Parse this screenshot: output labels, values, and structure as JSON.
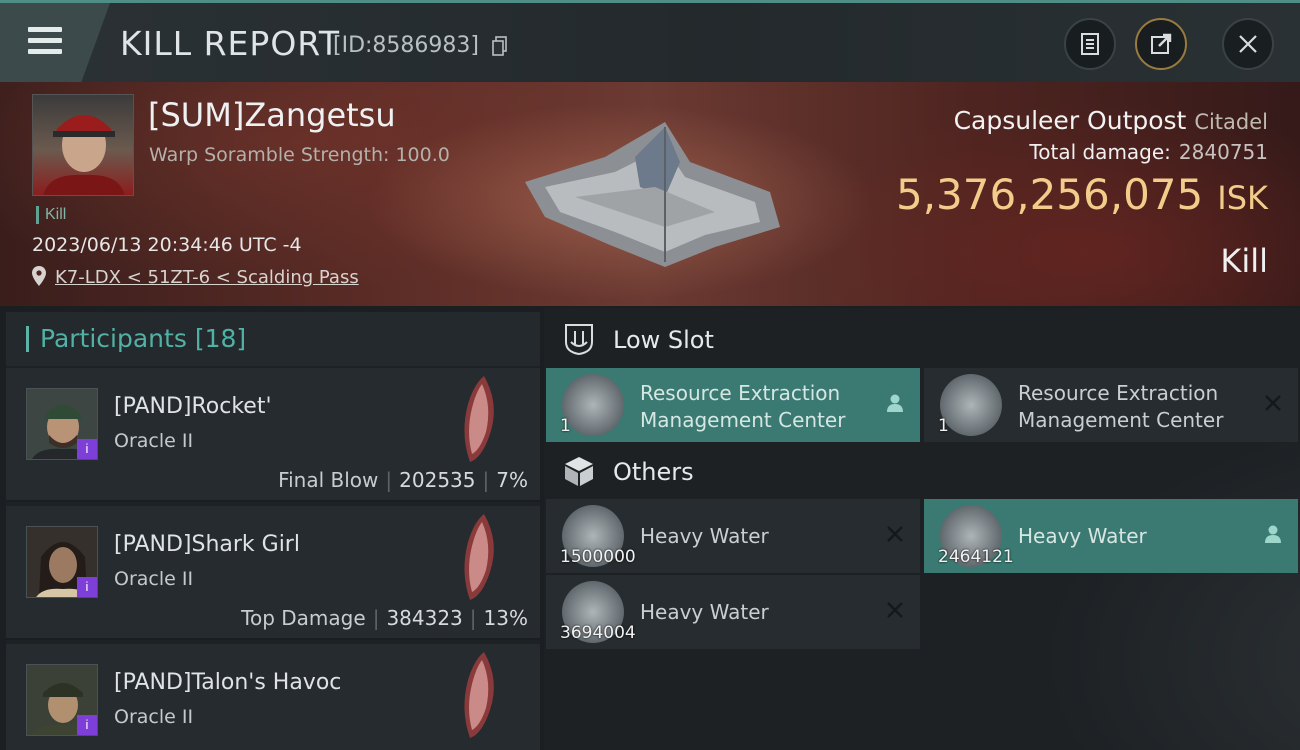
{
  "header": {
    "title": "KILL REPORT",
    "report_id": "[ID:8586983]"
  },
  "victim": {
    "name": "[SUM]Zangetsu",
    "subtitle": "Warp Soramble Strength: 100.0",
    "tag": "Kill",
    "timestamp": "2023/06/13 20:34:46 UTC -4",
    "location": "K7-LDX < 51ZT-6 < Scalding Pass",
    "structure_name": "Capsuleer Outpost",
    "structure_class": "Citadel",
    "total_damage_label": "Total damage:",
    "total_damage": "2840751",
    "isk_value": "5,376,256,075",
    "isk_unit": "ISK",
    "result": "Kill"
  },
  "participants": {
    "title": "Participants",
    "count": "[18]",
    "rows": [
      {
        "name": "[PAND]Rocket'",
        "ship": "Oracle II",
        "role": "Final Blow",
        "damage": "202535",
        "percent": "7%"
      },
      {
        "name": "[PAND]Shark Girl",
        "ship": "Oracle II",
        "role": "Top Damage",
        "damage": "384323",
        "percent": "13%"
      },
      {
        "name": "[PAND]Talon's Havoc",
        "ship": "Oracle II"
      }
    ]
  },
  "low_slot": {
    "label": "Low Slot",
    "items": [
      {
        "line1": "Resource Extraction",
        "line2": "Management Center",
        "qty": "1",
        "status": "dropped"
      },
      {
        "line1": "Resource Extraction",
        "line2": "Management Center",
        "qty": "1",
        "status": "destroyed"
      }
    ]
  },
  "others": {
    "label": "Others",
    "items": [
      {
        "name": "Heavy Water",
        "qty": "1500000",
        "status": "destroyed"
      },
      {
        "name": "Heavy Water",
        "qty": "2464121",
        "status": "dropped"
      },
      {
        "name": "Heavy Water",
        "qty": "3694004",
        "status": "destroyed"
      }
    ]
  },
  "colors": {
    "accent": "#52b1a5",
    "isk": "#f2cc8a",
    "dropped_bg": "#3b7a72",
    "badge": "#7d3fd8"
  },
  "icons": [
    "menu-icon",
    "copy-icon",
    "clipboard-icon",
    "share-icon",
    "close-icon",
    "location-pin-icon",
    "low-slot-icon",
    "cargo-box-icon",
    "dropped-person-icon",
    "destroyed-x-icon"
  ]
}
